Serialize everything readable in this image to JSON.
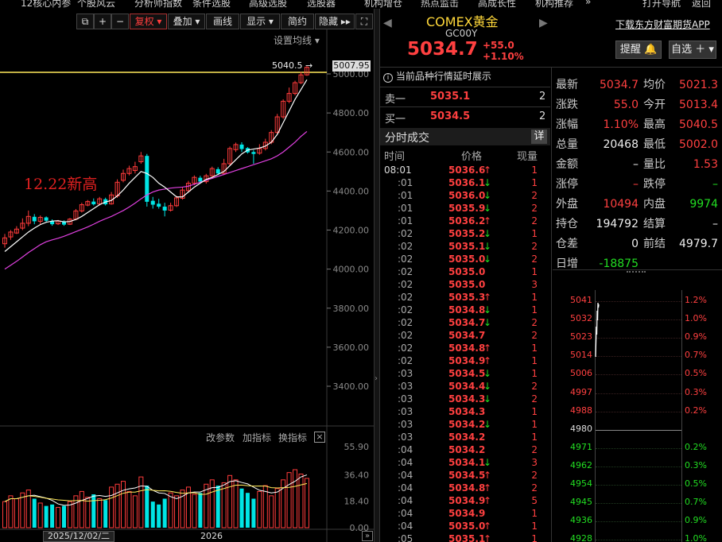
{
  "top_menu": [
    "12核心内参",
    "个股风云",
    "分析师指数",
    "条件选股",
    "高级选股",
    "选股器",
    "机构增仓",
    "热点监击",
    "高成长性",
    "机构推荐",
    "»",
    "打开导航",
    "返回"
  ],
  "toolbar": {
    "fuquan": "复权",
    "diejia": "叠加",
    "huaxian": "画线",
    "xianshi": "显示",
    "jianyue": "简约",
    "yincang": "隐藏"
  },
  "chart": {
    "settings_label": "设置均线",
    "annotation": "12.22新高",
    "high_marker": "5040.5",
    "price_badge": "5007.95",
    "y_ticks": [
      "5000.00",
      "4800.00",
      "4600.00",
      "4400.00",
      "4200.00",
      "4000.00",
      "3800.00",
      "3600.00",
      "3400.00"
    ],
    "vol_ticks": [
      "55.90",
      "36.40",
      "18.40",
      "0.00"
    ],
    "indicator_labels": {
      "param": "改参数",
      "add": "加指标",
      "switch": "换指标"
    },
    "date_label": "2025/12/02/二",
    "year_label": "2026",
    "close_icon": "close-icon",
    "colors": {
      "up": "#ff3b3b",
      "down": "#00e5e5",
      "ma5": "#ffffff",
      "ma10": "#e040e0",
      "highline": "#ffe95a"
    }
  },
  "chart_data": {
    "type": "candlestick",
    "ylim": [
      3300,
      5100
    ],
    "candles": [
      {
        "o": 4130,
        "c": 4160,
        "h": 4180,
        "l": 4110
      },
      {
        "o": 4165,
        "c": 4190,
        "h": 4200,
        "l": 4150
      },
      {
        "o": 4185,
        "c": 4205,
        "h": 4220,
        "l": 4180
      },
      {
        "o": 4210,
        "c": 4235,
        "h": 4260,
        "l": 4200
      },
      {
        "o": 4235,
        "c": 4270,
        "h": 4300,
        "l": 4220
      },
      {
        "o": 4268,
        "c": 4245,
        "h": 4282,
        "l": 4230
      },
      {
        "o": 4245,
        "c": 4265,
        "h": 4275,
        "l": 4230
      },
      {
        "o": 4265,
        "c": 4248,
        "h": 4270,
        "l": 4240
      },
      {
        "o": 4245,
        "c": 4230,
        "h": 4255,
        "l": 4222
      },
      {
        "o": 4232,
        "c": 4246,
        "h": 4252,
        "l": 4226
      },
      {
        "o": 4245,
        "c": 4228,
        "h": 4250,
        "l": 4222
      },
      {
        "o": 4230,
        "c": 4256,
        "h": 4262,
        "l": 4226
      },
      {
        "o": 4256,
        "c": 4298,
        "h": 4308,
        "l": 4250
      },
      {
        "o": 4298,
        "c": 4330,
        "h": 4340,
        "l": 4290
      },
      {
        "o": 4328,
        "c": 4346,
        "h": 4354,
        "l": 4322
      },
      {
        "o": 4346,
        "c": 4332,
        "h": 4362,
        "l": 4326
      },
      {
        "o": 4334,
        "c": 4360,
        "h": 4370,
        "l": 4326
      },
      {
        "o": 4358,
        "c": 4332,
        "h": 4366,
        "l": 4326
      },
      {
        "o": 4334,
        "c": 4380,
        "h": 4395,
        "l": 4330
      },
      {
        "o": 4375,
        "c": 4445,
        "h": 4460,
        "l": 4365
      },
      {
        "o": 4455,
        "c": 4490,
        "h": 4510,
        "l": 4445
      },
      {
        "o": 4490,
        "c": 4515,
        "h": 4530,
        "l": 4480
      },
      {
        "o": 4505,
        "c": 4525,
        "h": 4550,
        "l": 4490
      },
      {
        "o": 4550,
        "c": 4580,
        "h": 4600,
        "l": 4540
      },
      {
        "o": 4580,
        "c": 4345,
        "h": 4590,
        "l": 4320
      },
      {
        "o": 4350,
        "c": 4330,
        "h": 4370,
        "l": 4310
      },
      {
        "o": 4335,
        "c": 4320,
        "h": 4360,
        "l": 4310
      },
      {
        "o": 4320,
        "c": 4300,
        "h": 4340,
        "l": 4270
      },
      {
        "o": 4302,
        "c": 4325,
        "h": 4340,
        "l": 4295
      },
      {
        "o": 4325,
        "c": 4365,
        "h": 4375,
        "l": 4318
      },
      {
        "o": 4363,
        "c": 4405,
        "h": 4418,
        "l": 4356
      },
      {
        "o": 4402,
        "c": 4440,
        "h": 4452,
        "l": 4394
      },
      {
        "o": 4440,
        "c": 4470,
        "h": 4480,
        "l": 4430
      },
      {
        "o": 4468,
        "c": 4448,
        "h": 4478,
        "l": 4438
      },
      {
        "o": 4448,
        "c": 4478,
        "h": 4488,
        "l": 4438
      },
      {
        "o": 4478,
        "c": 4515,
        "h": 4525,
        "l": 4470
      },
      {
        "o": 4512,
        "c": 4490,
        "h": 4522,
        "l": 4482
      },
      {
        "o": 4490,
        "c": 4540,
        "h": 4565,
        "l": 4482
      },
      {
        "o": 4540,
        "c": 4618,
        "h": 4628,
        "l": 4530
      },
      {
        "o": 4612,
        "c": 4638,
        "h": 4648,
        "l": 4600
      },
      {
        "o": 4638,
        "c": 4615,
        "h": 4650,
        "l": 4600
      },
      {
        "o": 4620,
        "c": 4598,
        "h": 4625,
        "l": 4592
      },
      {
        "o": 4600,
        "c": 4590,
        "h": 4610,
        "l": 4540
      },
      {
        "o": 4594,
        "c": 4618,
        "h": 4640,
        "l": 4586
      },
      {
        "o": 4618,
        "c": 4650,
        "h": 4668,
        "l": 4608
      },
      {
        "o": 4650,
        "c": 4700,
        "h": 4712,
        "l": 4640
      },
      {
        "o": 4700,
        "c": 4780,
        "h": 4795,
        "l": 4690
      },
      {
        "o": 4780,
        "c": 4860,
        "h": 4870,
        "l": 4770
      },
      {
        "o": 4860,
        "c": 4900,
        "h": 4930,
        "l": 4850
      },
      {
        "o": 4900,
        "c": 4955,
        "h": 4965,
        "l": 4890
      },
      {
        "o": 4955,
        "c": 4995,
        "h": 5010,
        "l": 4948
      },
      {
        "o": 4995,
        "c": 5034,
        "h": 5040,
        "l": 4990
      }
    ],
    "ma5": [
      4090,
      4115,
      4140,
      4165,
      4190,
      4210,
      4228,
      4240,
      4246,
      4248,
      4242,
      4244,
      4254,
      4270,
      4290,
      4310,
      4330,
      4344,
      4352,
      4375,
      4405,
      4440,
      4470,
      4500,
      4490,
      4470,
      4440,
      4420,
      4395,
      4370,
      4370,
      4395,
      4420,
      4440,
      4460,
      4470,
      4485,
      4500,
      4530,
      4560,
      4590,
      4610,
      4615,
      4620,
      4630,
      4650,
      4690,
      4750,
      4810,
      4870,
      4920,
      4970
    ],
    "ma10": [
      4000,
      4020,
      4040,
      4062,
      4085,
      4105,
      4125,
      4140,
      4150,
      4158,
      4168,
      4180,
      4192,
      4204,
      4216,
      4230,
      4245,
      4258,
      4270,
      4285,
      4300,
      4318,
      4338,
      4360,
      4380,
      4395,
      4405,
      4410,
      4415,
      4418,
      4420,
      4425,
      4435,
      4445,
      4455,
      4465,
      4475,
      4485,
      4495,
      4505,
      4515,
      4525,
      4535,
      4545,
      4555,
      4565,
      4580,
      4600,
      4625,
      4650,
      4680,
      4705
    ],
    "volumes": [
      18,
      22,
      20,
      24,
      26,
      20,
      17,
      15,
      16,
      14,
      15,
      18,
      22,
      25,
      21,
      23,
      20,
      19,
      28,
      30,
      32,
      25,
      22,
      35,
      29,
      18,
      16,
      20,
      24,
      22,
      26,
      28,
      23,
      24,
      30,
      33,
      29,
      31,
      36,
      33,
      27,
      24,
      20,
      25,
      29,
      22,
      27,
      33,
      38,
      40,
      37,
      34
    ],
    "volume_ylim": [
      0,
      55.9
    ]
  },
  "right": {
    "title": "COMEX黄金",
    "code": "GC00Y",
    "price": "5034.7",
    "change": "+55.0",
    "change_pct": "+1.10%",
    "download_link": "下载东方财富期货APP",
    "alert_btn": "提醒",
    "watch_btn": "自选",
    "delay_notice": "当前品种行情延时展示",
    "sell_label": "卖一",
    "sell_price": "5035.1",
    "sell_qty": "2",
    "buy_label": "买一",
    "buy_price": "5034.5",
    "buy_qty": "2",
    "trades_title": "分时成交",
    "trades_detail": "详",
    "trades_headers": [
      "时间",
      "价格",
      "现量"
    ],
    "trades": [
      {
        "t": "08:01",
        "p": "5036.6",
        "d": "up",
        "v": "1"
      },
      {
        "t": ":01",
        "p": "5036.1",
        "d": "down",
        "v": "1"
      },
      {
        "t": ":01",
        "p": "5036.0",
        "d": "down",
        "v": "2"
      },
      {
        "t": ":01",
        "p": "5035.9",
        "d": "down",
        "v": "2"
      },
      {
        "t": ":01",
        "p": "5036.2",
        "d": "up",
        "v": "2"
      },
      {
        "t": ":02",
        "p": "5035.2",
        "d": "down",
        "v": "1"
      },
      {
        "t": ":02",
        "p": "5035.1",
        "d": "down",
        "v": "2"
      },
      {
        "t": ":02",
        "p": "5035.0",
        "d": "down",
        "v": "2"
      },
      {
        "t": ":02",
        "p": "5035.0",
        "d": "",
        "v": "1"
      },
      {
        "t": ":02",
        "p": "5035.0",
        "d": "",
        "v": "3"
      },
      {
        "t": ":02",
        "p": "5035.3",
        "d": "up",
        "v": "1"
      },
      {
        "t": ":02",
        "p": "5034.8",
        "d": "down",
        "v": "1"
      },
      {
        "t": ":02",
        "p": "5034.7",
        "d": "down",
        "v": "2"
      },
      {
        "t": ":02",
        "p": "5034.7",
        "d": "",
        "v": "2"
      },
      {
        "t": ":02",
        "p": "5034.8",
        "d": "up",
        "v": "1"
      },
      {
        "t": ":02",
        "p": "5034.9",
        "d": "up",
        "v": "1"
      },
      {
        "t": ":03",
        "p": "5034.5",
        "d": "down",
        "v": "1"
      },
      {
        "t": ":03",
        "p": "5034.4",
        "d": "down",
        "v": "2"
      },
      {
        "t": ":03",
        "p": "5034.3",
        "d": "down",
        "v": "2"
      },
      {
        "t": ":03",
        "p": "5034.3",
        "d": "",
        "v": "1"
      },
      {
        "t": ":03",
        "p": "5034.2",
        "d": "down",
        "v": "1"
      },
      {
        "t": ":03",
        "p": "5034.2",
        "d": "",
        "v": "1"
      },
      {
        "t": ":04",
        "p": "5034.2",
        "d": "",
        "v": "2"
      },
      {
        "t": ":04",
        "p": "5034.1",
        "d": "down",
        "v": "3"
      },
      {
        "t": ":04",
        "p": "5034.5",
        "d": "up",
        "v": "2"
      },
      {
        "t": ":04",
        "p": "5034.8",
        "d": "up",
        "v": "2"
      },
      {
        "t": ":04",
        "p": "5034.9",
        "d": "up",
        "v": "5"
      },
      {
        "t": ":04",
        "p": "5034.9",
        "d": "",
        "v": "1"
      },
      {
        "t": ":04",
        "p": "5035.0",
        "d": "up",
        "v": "1"
      },
      {
        "t": ":05",
        "p": "5035.1",
        "d": "up",
        "v": "1"
      }
    ],
    "quote": [
      {
        "k1": "最新",
        "v1": "5034.7",
        "c1": "red",
        "k2": "均价",
        "v2": "5021.3",
        "c2": "red"
      },
      {
        "k1": "涨跌",
        "v1": "55.0",
        "c1": "red",
        "k2": "今开",
        "v2": "5013.4",
        "c2": "red"
      },
      {
        "k1": "涨幅",
        "v1": "1.10%",
        "c1": "red",
        "k2": "最高",
        "v2": "5040.5",
        "c2": "red"
      },
      {
        "k1": "总量",
        "v1": "20468",
        "c1": "white",
        "k2": "最低",
        "v2": "5002.0",
        "c2": "red"
      },
      {
        "k1": "金额",
        "v1": "–",
        "c1": "white",
        "k2": "量比",
        "v2": "1.53",
        "c2": "red"
      },
      {
        "k1": "涨停",
        "v1": "–",
        "c1": "red",
        "k2": "跌停",
        "v2": "–",
        "c2": "green"
      },
      {
        "k1": "外盘",
        "v1": "10494",
        "c1": "red",
        "k2": "内盘",
        "v2": "9974",
        "c2": "green"
      },
      {
        "k1": "持仓",
        "v1": "194792",
        "c1": "white",
        "k2": "结算",
        "v2": "–",
        "c2": "white"
      },
      {
        "k1": "仓差",
        "v1": "0",
        "c1": "white",
        "k2": "前结",
        "v2": "4979.7",
        "c2": "white"
      },
      {
        "k1": "日增",
        "v1": "-18875",
        "c1": "green",
        "k2": "",
        "v2": "",
        "c2": "white"
      }
    ],
    "mini_left": [
      "5041",
      "5032",
      "5023",
      "5014",
      "5006",
      "4997",
      "4988",
      "4980",
      "4971",
      "4962",
      "4954",
      "4945",
      "4936",
      "4928"
    ],
    "mini_right": [
      "1.2%",
      "1.0%",
      "0.9%",
      "0.7%",
      "0.5%",
      "0.3%",
      "0.2%",
      "",
      "0.2%",
      "0.3%",
      "0.5%",
      "0.7%",
      "0.9%",
      "1.0%"
    ]
  }
}
